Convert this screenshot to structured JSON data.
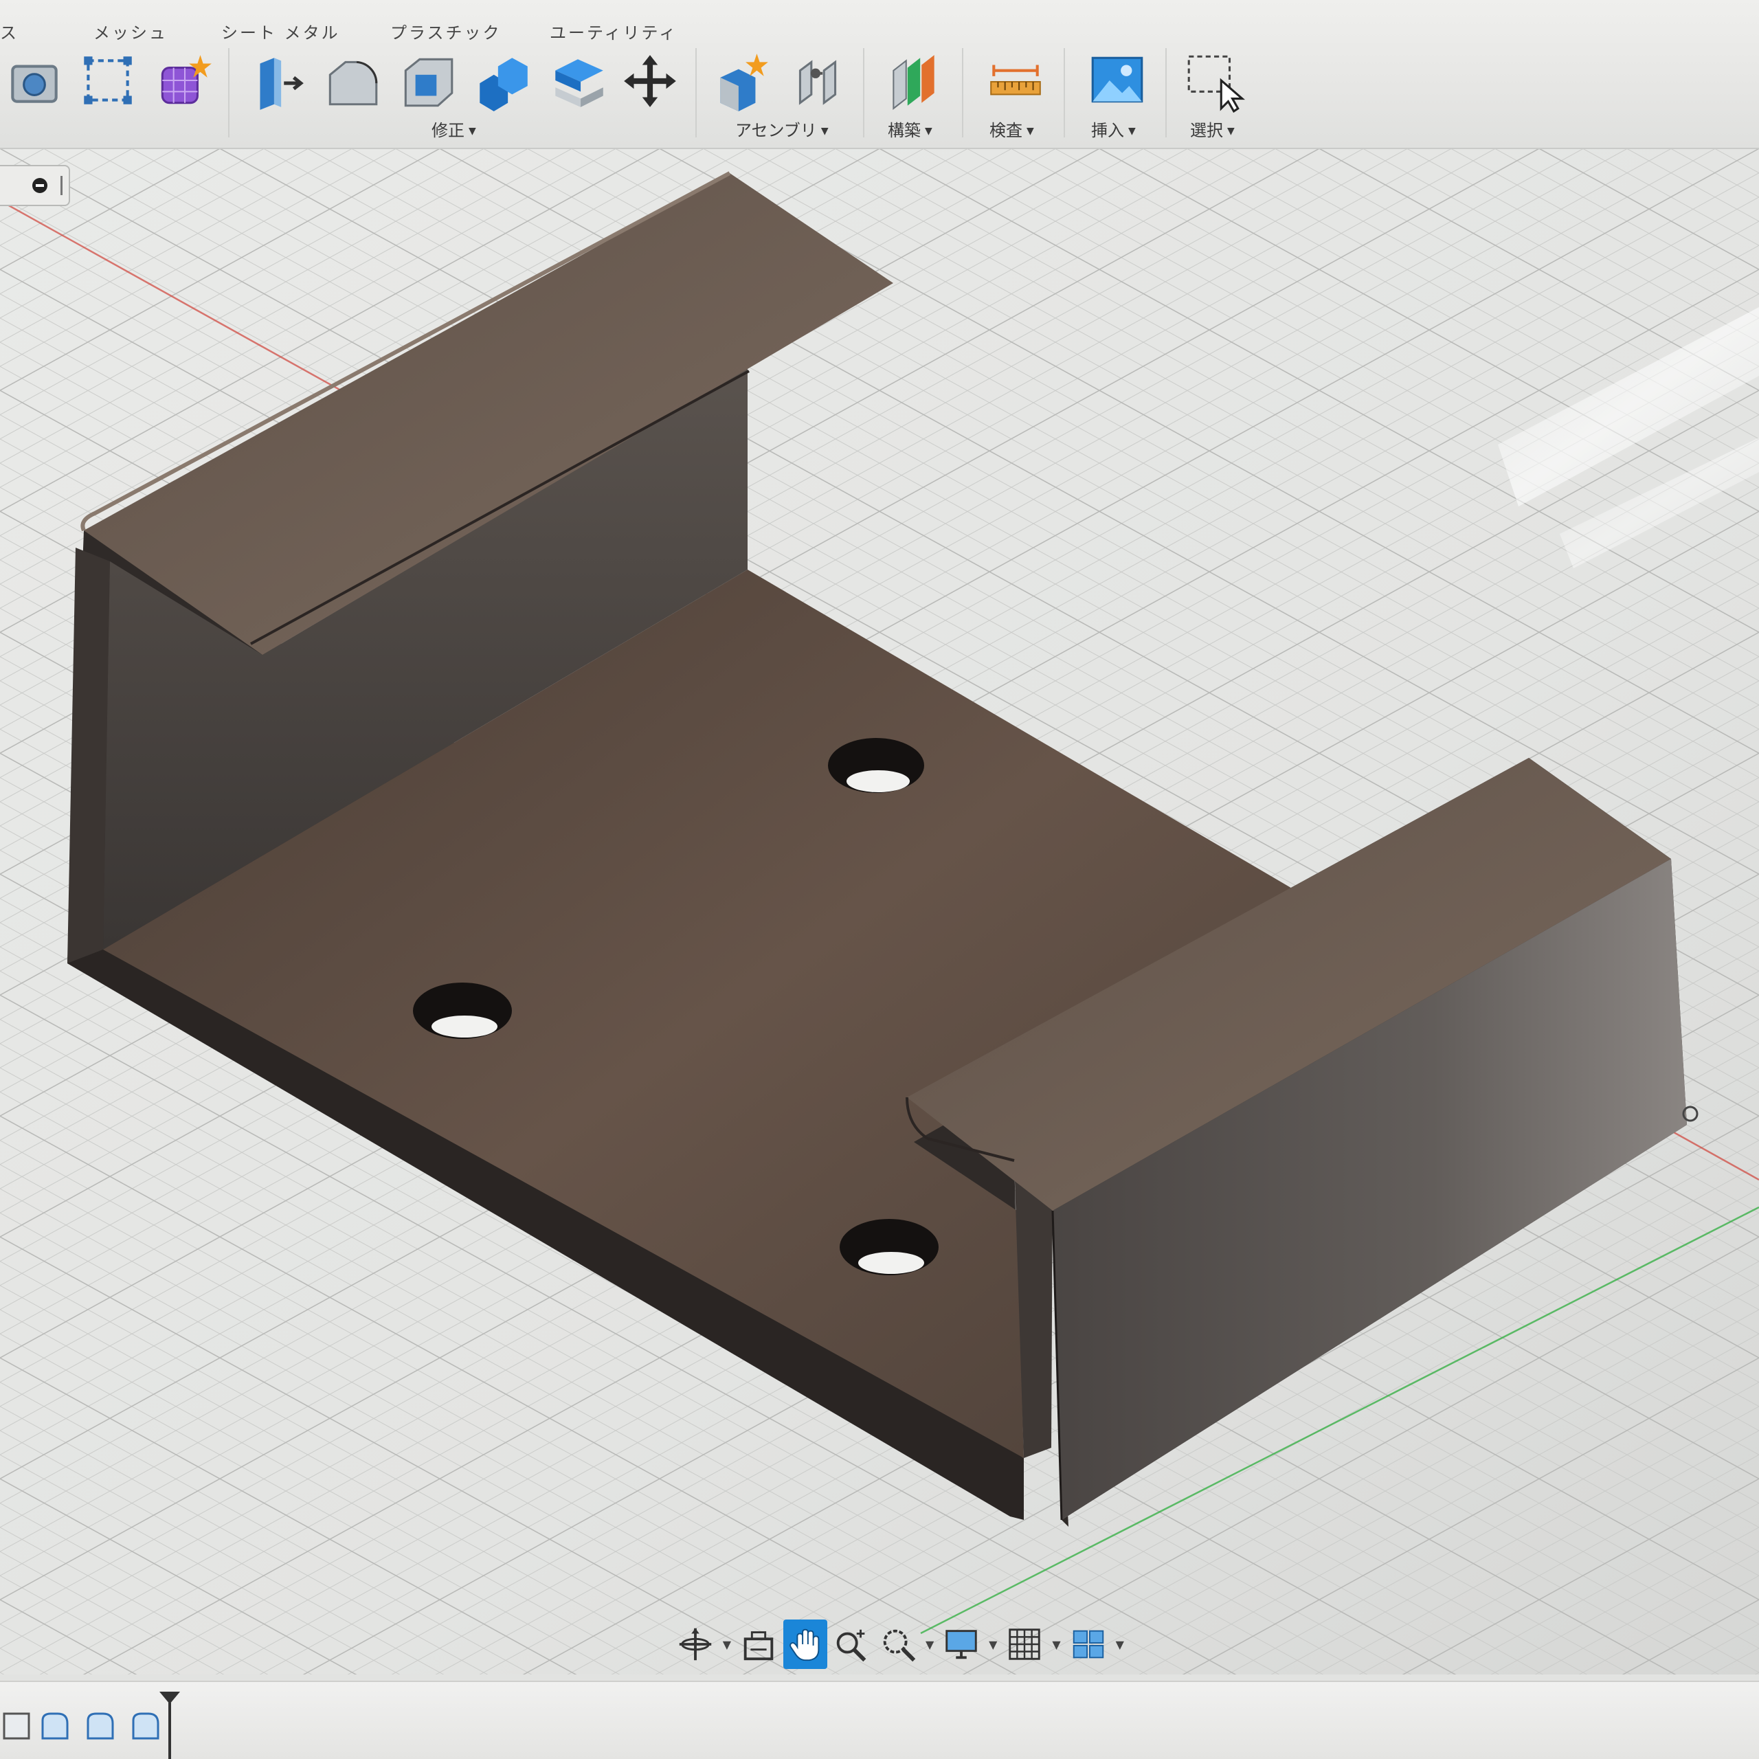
{
  "toolbar": {
    "tabs": {
      "partial": "ス",
      "mesh": "メッシュ",
      "sheet_metal": "シート メタル",
      "plastic": "プラスチック",
      "utility": "ユーティリティ"
    },
    "groups": {
      "modify": "修正",
      "assemble": "アセンブリ",
      "construct": "構築",
      "inspect": "検査",
      "insert": "挿入",
      "select": "選択"
    }
  },
  "icons": {
    "create": [
      "create-sketch-icon",
      "mesh-edge-icon",
      "form-create-icon"
    ],
    "modify": [
      "press-pull-icon",
      "fillet-icon",
      "shell-icon",
      "combine-icon",
      "offset-face-icon",
      "move-icon"
    ],
    "assemble": [
      "new-component-icon",
      "joint-icon"
    ],
    "construct": "offset-plane-icon",
    "inspect": "measure-icon",
    "insert": "insert-image-icon",
    "select": "window-select-icon",
    "nav": [
      "orbit-icon",
      "look-at-icon",
      "pan-icon",
      "zoom-icon",
      "fit-icon",
      "display-settings-icon",
      "grid-icon",
      "viewports-icon"
    ]
  },
  "navbar": {
    "active_tool": "pan"
  },
  "colors": {
    "accent": "#1b86d8",
    "model": "#5a4a40",
    "x_axis": "#d0433a",
    "z_axis": "#2fae3e"
  }
}
